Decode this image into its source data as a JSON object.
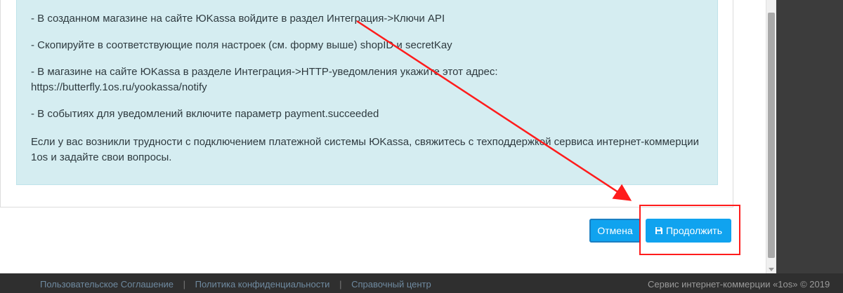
{
  "info": {
    "line1": "- В созданном магазине на сайте ЮKassa войдите в раздел Интеграция->Ключи API",
    "line2": "- Скопируйте в соответствующие поля настроек (см. форму выше) shopID и secretKay",
    "line3a": "- В магазине на сайте ЮKassa в разделе Интеграция->HTTP-уведомления укажите этот адрес:",
    "line3b": "https://butterfly.1os.ru/yookassa/notify",
    "line4": "- В событиях для уведомлений включите параметр payment.succeeded",
    "line5": "Если у вас возникли трудности с подключением платежной системы ЮKassa, свяжитесь с техподдержкой сервиса интернет-коммерции 1os и задайте свои вопросы."
  },
  "buttons": {
    "cancel_label": "Отмена",
    "continue_label": "Продолжить"
  },
  "footer": {
    "links": [
      "Пользовательское Соглашение",
      "Политика конфиденциальности",
      "Справочный центр"
    ],
    "copyright": "Сервис интернет-коммерции «1os» © 2019"
  },
  "colors": {
    "accent": "#10a3ef",
    "info_bg": "#d5edf1",
    "annotation": "#ff1c1c"
  },
  "icons": {
    "continue": "floppy-disk-icon"
  }
}
